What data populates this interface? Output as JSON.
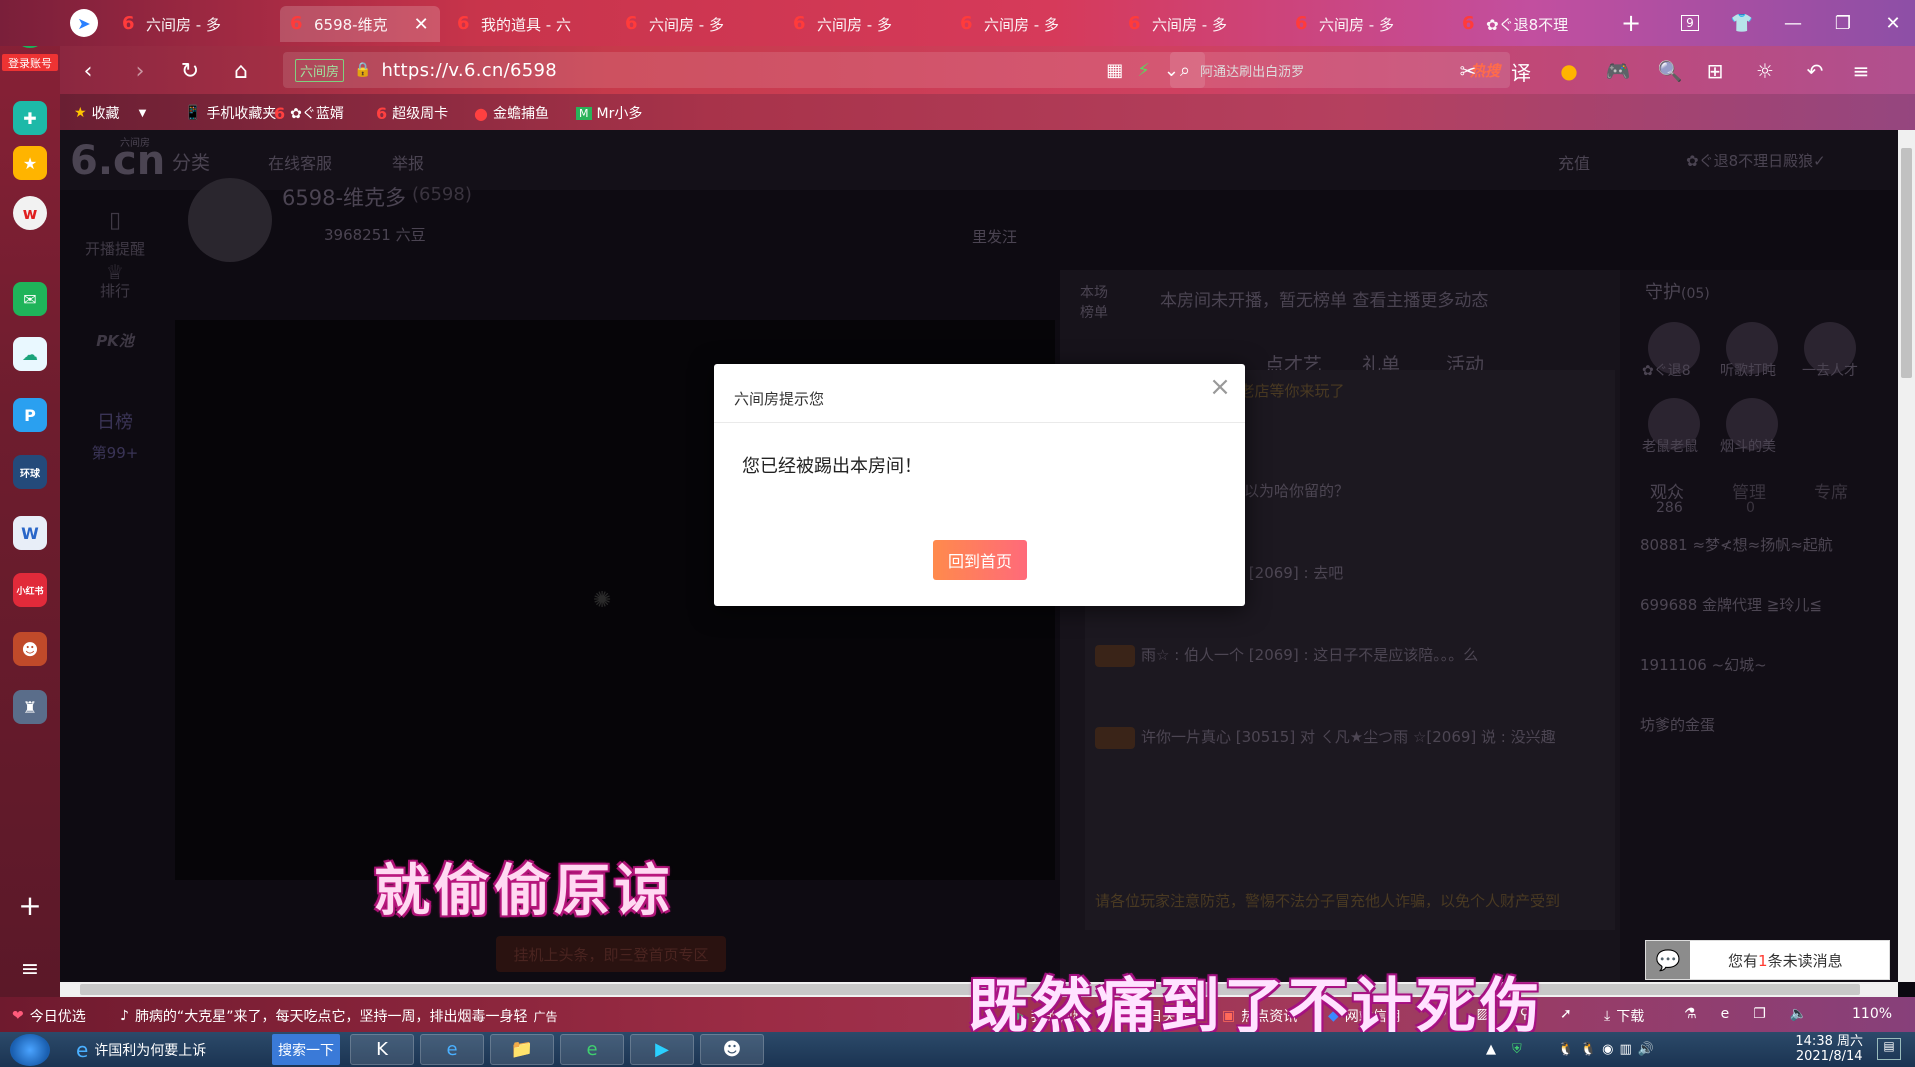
{
  "browser": {
    "tabs": [
      {
        "title": "六间房 - 多",
        "active": false
      },
      {
        "title": "6598-维克",
        "active": true
      },
      {
        "title": "我的道具 - 六",
        "active": false
      },
      {
        "title": "六间房 - 多",
        "active": false
      },
      {
        "title": "六间房 - 多",
        "active": false
      },
      {
        "title": "六间房 - 多",
        "active": false
      },
      {
        "title": "六间房 - 多",
        "active": false
      },
      {
        "title": "六间房 - 多",
        "active": false
      },
      {
        "title": "✿ぐ退8不理",
        "active": false
      }
    ],
    "tab_count": "9",
    "url_badge": "六间房",
    "url": "https://v.6.cn/6598",
    "search_placeholder": "阿通达刷出白沥罗",
    "hot_label": "热搜",
    "bookmarks": [
      "收藏",
      "手机收藏夹",
      "✿ぐ蓝婿",
      "超级周卡",
      "金蟾捕鱼",
      "Mr小多"
    ],
    "login_label": "登录账号"
  },
  "page": {
    "logo": "6.cn",
    "logo_small": "六间房",
    "nav": [
      "分类",
      "在线客服",
      "举报"
    ],
    "recharge": "充值",
    "user": "✿ぐ退8不理日殿狼✓",
    "anchor_name": "6598-维克多",
    "anchor_id": "(6598)",
    "anchor_beans": "3968251 六豆",
    "follow_label": "里发汪",
    "left_nav": [
      "开播提醒",
      "排行",
      "PK池",
      "日榜",
      "第99+"
    ],
    "rank_header": "本场榜单",
    "rank_empty": "本房间未开播，暂无榜单 查看主播更多动态",
    "tabs": [
      "点才艺",
      "礼单",
      "活动"
    ],
    "top_notice": "代理 代理玛玲姐 金牌老店等你来玩了",
    "chat_lines": [
      "ㄑ凡★尘つ : 你以为哈你留的？",
      "雨☆ : 伯人一个 [2069] : 去吧",
      "雨☆ : 伯人一个 [2069] : 这日子不是应该陪。。。么",
      "许你一片真心 [30515] 对 ㄑ凡★尘つ雨 ☆[2069] 说 : 没兴趣",
      "请各位玩家注意防范，警惕不法分子冒充他人诈骗，以免个人财产受到"
    ],
    "guard_title": "守护",
    "guard_count": "(05)",
    "guards": [
      "✿ぐ退8",
      "听歌打盹",
      "一去人才",
      "老鼠老鼠",
      "烟斗的美"
    ],
    "audience_tabs": [
      {
        "label": "观众",
        "count": "286"
      },
      {
        "label": "管理",
        "count": "0"
      },
      {
        "label": "专席",
        "count": ""
      }
    ],
    "audience": [
      "80881 ≈梦≮想≈扬帆≈起航",
      "699688 金牌代理 ≧玲儿≦",
      "1911106 ~幻城~",
      "坊爹的金蛋"
    ],
    "bottom_banner": "挂机上头条，即三登首页专区"
  },
  "modal": {
    "title": "六间房提示您",
    "message": "您已经被踢出本房间！",
    "button": "回到首页",
    "close": "×"
  },
  "subtitles": [
    "就偷偷原谅",
    "既然痛到了不计死伤"
  ],
  "unread": {
    "prefix": "您有",
    "count": "1",
    "suffix": "条未读消息"
  },
  "statusbar": {
    "today": "今日优选",
    "news": "肺病的“大克星”来了，每天吃点它，坚持一周，排出烟毒一身轻",
    "ad": "广告",
    "items": [
      "我的视频",
      "每日关注",
      "热点资讯",
      "网站信用"
    ],
    "download": "下载",
    "zoom": "110%"
  },
  "taskbar": {
    "ie_title": "许国利为何要上诉",
    "search_btn": "搜索一下",
    "time": "14:38 周六",
    "date": "2021/8/14"
  }
}
